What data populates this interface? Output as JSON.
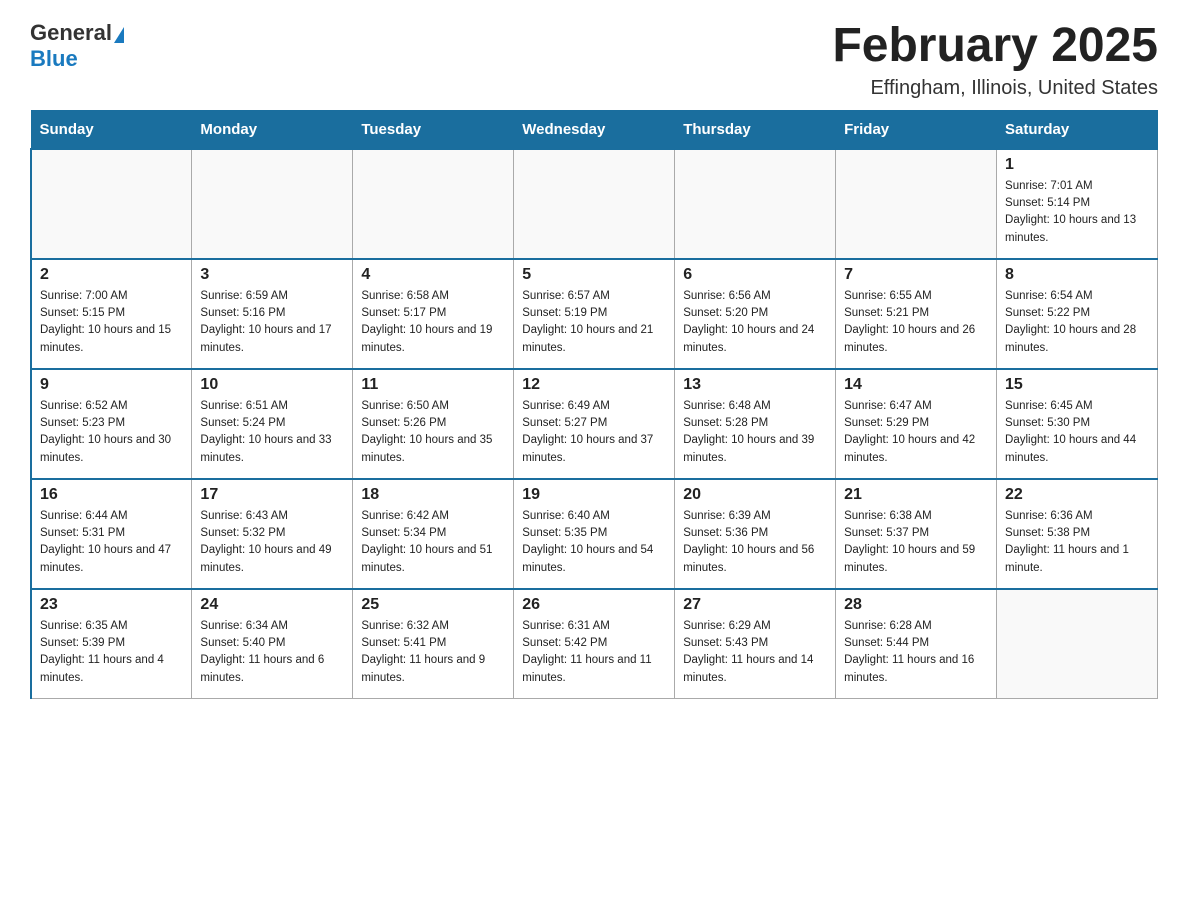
{
  "header": {
    "logo": {
      "general": "General",
      "blue": "Blue"
    },
    "title": "February 2025",
    "location": "Effingham, Illinois, United States"
  },
  "calendar": {
    "days_of_week": [
      "Sunday",
      "Monday",
      "Tuesday",
      "Wednesday",
      "Thursday",
      "Friday",
      "Saturday"
    ],
    "weeks": [
      [
        {
          "day": "",
          "info": ""
        },
        {
          "day": "",
          "info": ""
        },
        {
          "day": "",
          "info": ""
        },
        {
          "day": "",
          "info": ""
        },
        {
          "day": "",
          "info": ""
        },
        {
          "day": "",
          "info": ""
        },
        {
          "day": "1",
          "info": "Sunrise: 7:01 AM\nSunset: 5:14 PM\nDaylight: 10 hours and 13 minutes."
        }
      ],
      [
        {
          "day": "2",
          "info": "Sunrise: 7:00 AM\nSunset: 5:15 PM\nDaylight: 10 hours and 15 minutes."
        },
        {
          "day": "3",
          "info": "Sunrise: 6:59 AM\nSunset: 5:16 PM\nDaylight: 10 hours and 17 minutes."
        },
        {
          "day": "4",
          "info": "Sunrise: 6:58 AM\nSunset: 5:17 PM\nDaylight: 10 hours and 19 minutes."
        },
        {
          "day": "5",
          "info": "Sunrise: 6:57 AM\nSunset: 5:19 PM\nDaylight: 10 hours and 21 minutes."
        },
        {
          "day": "6",
          "info": "Sunrise: 6:56 AM\nSunset: 5:20 PM\nDaylight: 10 hours and 24 minutes."
        },
        {
          "day": "7",
          "info": "Sunrise: 6:55 AM\nSunset: 5:21 PM\nDaylight: 10 hours and 26 minutes."
        },
        {
          "day": "8",
          "info": "Sunrise: 6:54 AM\nSunset: 5:22 PM\nDaylight: 10 hours and 28 minutes."
        }
      ],
      [
        {
          "day": "9",
          "info": "Sunrise: 6:52 AM\nSunset: 5:23 PM\nDaylight: 10 hours and 30 minutes."
        },
        {
          "day": "10",
          "info": "Sunrise: 6:51 AM\nSunset: 5:24 PM\nDaylight: 10 hours and 33 minutes."
        },
        {
          "day": "11",
          "info": "Sunrise: 6:50 AM\nSunset: 5:26 PM\nDaylight: 10 hours and 35 minutes."
        },
        {
          "day": "12",
          "info": "Sunrise: 6:49 AM\nSunset: 5:27 PM\nDaylight: 10 hours and 37 minutes."
        },
        {
          "day": "13",
          "info": "Sunrise: 6:48 AM\nSunset: 5:28 PM\nDaylight: 10 hours and 39 minutes."
        },
        {
          "day": "14",
          "info": "Sunrise: 6:47 AM\nSunset: 5:29 PM\nDaylight: 10 hours and 42 minutes."
        },
        {
          "day": "15",
          "info": "Sunrise: 6:45 AM\nSunset: 5:30 PM\nDaylight: 10 hours and 44 minutes."
        }
      ],
      [
        {
          "day": "16",
          "info": "Sunrise: 6:44 AM\nSunset: 5:31 PM\nDaylight: 10 hours and 47 minutes."
        },
        {
          "day": "17",
          "info": "Sunrise: 6:43 AM\nSunset: 5:32 PM\nDaylight: 10 hours and 49 minutes."
        },
        {
          "day": "18",
          "info": "Sunrise: 6:42 AM\nSunset: 5:34 PM\nDaylight: 10 hours and 51 minutes."
        },
        {
          "day": "19",
          "info": "Sunrise: 6:40 AM\nSunset: 5:35 PM\nDaylight: 10 hours and 54 minutes."
        },
        {
          "day": "20",
          "info": "Sunrise: 6:39 AM\nSunset: 5:36 PM\nDaylight: 10 hours and 56 minutes."
        },
        {
          "day": "21",
          "info": "Sunrise: 6:38 AM\nSunset: 5:37 PM\nDaylight: 10 hours and 59 minutes."
        },
        {
          "day": "22",
          "info": "Sunrise: 6:36 AM\nSunset: 5:38 PM\nDaylight: 11 hours and 1 minute."
        }
      ],
      [
        {
          "day": "23",
          "info": "Sunrise: 6:35 AM\nSunset: 5:39 PM\nDaylight: 11 hours and 4 minutes."
        },
        {
          "day": "24",
          "info": "Sunrise: 6:34 AM\nSunset: 5:40 PM\nDaylight: 11 hours and 6 minutes."
        },
        {
          "day": "25",
          "info": "Sunrise: 6:32 AM\nSunset: 5:41 PM\nDaylight: 11 hours and 9 minutes."
        },
        {
          "day": "26",
          "info": "Sunrise: 6:31 AM\nSunset: 5:42 PM\nDaylight: 11 hours and 11 minutes."
        },
        {
          "day": "27",
          "info": "Sunrise: 6:29 AM\nSunset: 5:43 PM\nDaylight: 11 hours and 14 minutes."
        },
        {
          "day": "28",
          "info": "Sunrise: 6:28 AM\nSunset: 5:44 PM\nDaylight: 11 hours and 16 minutes."
        },
        {
          "day": "",
          "info": ""
        }
      ]
    ]
  }
}
